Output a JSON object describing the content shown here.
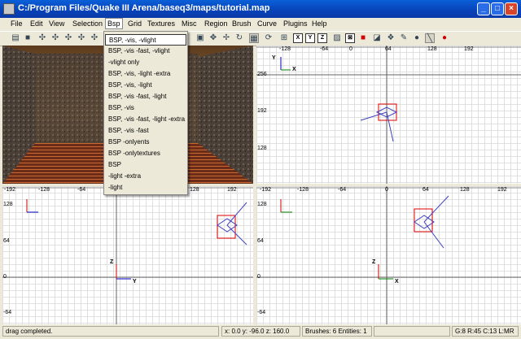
{
  "window": {
    "title": "C:/Program Files/Quake III Arena/baseq3/maps/tutorial.map"
  },
  "menu": {
    "items": [
      "File",
      "Edit",
      "View",
      "Selection",
      "Bsp",
      "Grid",
      "Textures",
      "Misc",
      "Region",
      "Brush",
      "Curve",
      "Plugins",
      "Help"
    ]
  },
  "bsp_menu": {
    "items": [
      "BSP, -vis, -vlight",
      "BSP, -vis -fast, -vlight",
      "-vlight only",
      "BSP, -vis, -light -extra",
      "BSP, -vis, -light",
      "BSP, -vis -fast, -light",
      "BSP, -vis",
      "BSP, -vis -fast, -light -extra",
      "BSP, -vis -fast",
      "BSP -onlyents",
      "BSP -onlytextures",
      "BSP",
      "-light -extra",
      "-light"
    ]
  },
  "toolbar": {
    "x_label": "X",
    "y_label": "Y",
    "z_label": "Z"
  },
  "views": {
    "top_right": {
      "top_ticks": [
        "-128",
        "-64",
        "0",
        "64",
        "128",
        "192"
      ],
      "left_ticks": [
        "256",
        "192",
        "128"
      ],
      "axis_v": "Y",
      "axis_h": "X"
    },
    "bottom_left": {
      "top_ticks": [
        "-192",
        "-128",
        "-64",
        "0",
        "64",
        "128",
        "192"
      ],
      "left_ticks": [
        "128",
        "64",
        "0",
        "-64"
      ],
      "axis_v": "Z",
      "axis_h": "Y"
    },
    "bottom_right": {
      "top_ticks": [
        "-192",
        "-128",
        "-64",
        "0",
        "64",
        "128",
        "192"
      ],
      "left_ticks": [
        "128",
        "64",
        "0",
        "-64"
      ],
      "axis_v": "Z",
      "axis_h": "X"
    }
  },
  "status": {
    "message": "drag completed.",
    "coords": "x: 0.0  y: -96.0  z: 160.0",
    "counts": "Brushes: 6 Entities: 1",
    "grid": "G:8 R:45 C:13 L:MR"
  },
  "colors": {
    "titlebar": "#0842b8",
    "axis_red": "#d00000",
    "axis_blue": "#0000c0",
    "axis_green": "#008000",
    "brush": "#e00000",
    "entity": "#4040c0"
  }
}
